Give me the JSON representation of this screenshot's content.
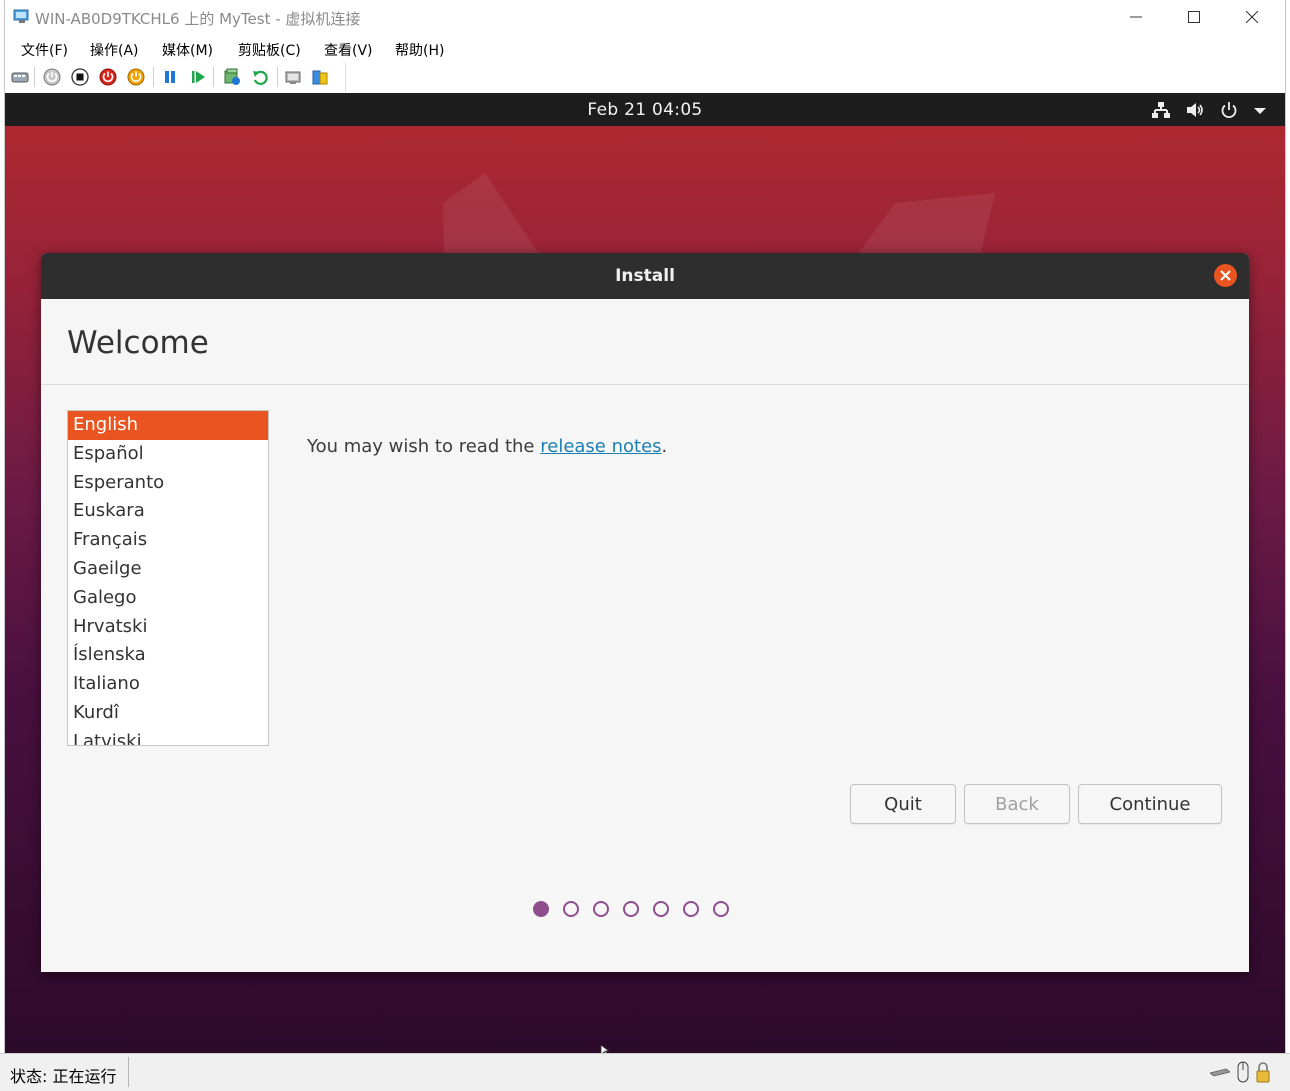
{
  "host": {
    "title": "WIN-AB0D9TKCHL6 上的 MyTest - 虚拟机连接",
    "menu": [
      "文件(F)",
      "操作(A)",
      "媒体(M)",
      "剪贴板(C)",
      "查看(V)",
      "帮助(H)"
    ],
    "toolbar_icons": [
      "ctrl-alt-del-icon",
      "start-icon",
      "turn-off-icon",
      "shut-down-icon",
      "save-icon",
      "pause-icon",
      "resume-icon",
      "checkpoint-icon",
      "revert-icon",
      "enhanced-session-icon",
      "share-icon"
    ],
    "status": "状态: 正在运行"
  },
  "vm": {
    "topbar": {
      "clock": "Feb 21  04:05"
    },
    "installer": {
      "title": "Install",
      "heading": "Welcome",
      "languages": [
        "English",
        "Español",
        "Esperanto",
        "Euskara",
        "Français",
        "Gaeilge",
        "Galego",
        "Hrvatski",
        "Íslenska",
        "Italiano",
        "Kurdî",
        "Latviski"
      ],
      "selected_language": "English",
      "release_prefix": "You may wish to read the ",
      "release_link": "release notes",
      "release_suffix": ".",
      "buttons": {
        "quit": "Quit",
        "back": "Back",
        "continue": "Continue"
      },
      "steps_total": 7,
      "step_current": 1
    }
  },
  "colors": {
    "accent": "#e95420",
    "progress": "#8e4e8e",
    "link": "#1c7fb1"
  }
}
